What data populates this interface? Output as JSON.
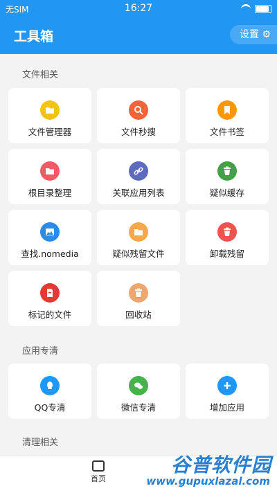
{
  "status": {
    "carrier": "无SIM",
    "time": "16:27"
  },
  "header": {
    "title": "工具箱",
    "settings": "设置"
  },
  "sections": {
    "files": "文件相关",
    "apps": "应用专清",
    "clean": "清理相关"
  },
  "items": [
    {
      "label": "文件管理器",
      "color": "#f1c40f",
      "icon": "folder-icon"
    },
    {
      "label": "文件秒搜",
      "color": "#f4633a",
      "icon": "search-icon"
    },
    {
      "label": "文件书签",
      "color": "#ff9800",
      "icon": "bookmark-icon"
    },
    {
      "label": "根目录整理",
      "color": "#f25b66",
      "icon": "folder-icon"
    },
    {
      "label": "关联应用列表",
      "color": "#5c6bc0",
      "icon": "link-icon"
    },
    {
      "label": "疑似缓存",
      "color": "#43a047",
      "icon": "trash-icon"
    },
    {
      "label": "查找.nomedia",
      "color": "#2d8ae6",
      "icon": "image-icon"
    },
    {
      "label": "疑似残留文件",
      "color": "#f5a94a",
      "icon": "folder-icon"
    },
    {
      "label": "卸载残留",
      "color": "#ef5350",
      "icon": "trash-icon"
    },
    {
      "label": "标记的文件",
      "color": "#e53935",
      "icon": "document-icon"
    },
    {
      "label": "回收站",
      "color": "#f0a66f",
      "icon": "trash-icon"
    },
    {
      "label": "QQ专清",
      "color": "#2196f3",
      "icon": "qq-icon"
    },
    {
      "label": "微信专清",
      "color": "#43b548",
      "icon": "wechat-icon"
    },
    {
      "label": "增加应用",
      "color": "#2196f3",
      "icon": "plus-icon"
    }
  ],
  "nav": {
    "home": "首页"
  },
  "watermark": {
    "line1": "谷普软件园",
    "line2": "www.gupuxlazal.com"
  }
}
